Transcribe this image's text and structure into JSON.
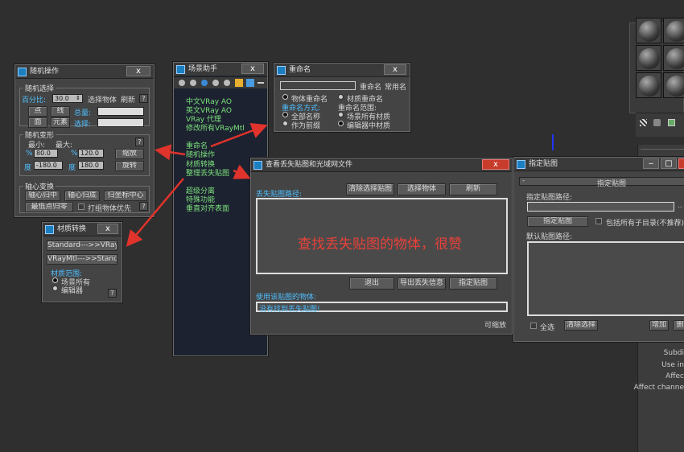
{
  "random_ops": {
    "title": "随机操作",
    "close": "x",
    "sec_random": "随机选择",
    "percent_label": "百分比:",
    "percent_value": "30.0",
    "btn_select_obj": "选择物体",
    "btn_refresh": "刷新",
    "q": "?",
    "btn_point": "点",
    "btn_line": "线",
    "btn_face": "面",
    "btn_element": "元素",
    "total_label": "总量:",
    "select_label": "选择:",
    "sec_transform": "随机变形",
    "min_label": "最小:",
    "max_label": "最大:",
    "pct": "%",
    "min_pct": "80.0",
    "max_pct": "120.0",
    "deg": "度",
    "min_deg": "-180.0",
    "max_deg": "180.0",
    "btn_scale": "缩放",
    "btn_rotate": "旋转",
    "sec_pivot": "轴心变换",
    "btn_pivot_center": "轴心归中",
    "btn_pivot_bottom": "轴心归底",
    "btn_world_center": "归坐标中心",
    "btn_lowest_zero": "最低点归零",
    "cb_group": "打组物体优先"
  },
  "mat_convert": {
    "title": "材质转换",
    "close": "x",
    "btn_std_to_vray": "Standard--->>VRayMtl",
    "btn_vray_to_std": "VRayMtl--->>Standard",
    "range_label": "材质范围:",
    "opt_scene": "场景所有",
    "opt_editor": "编辑器",
    "q": "?"
  },
  "scene_helper": {
    "title": "场景助手",
    "close": "x",
    "menu": [
      "中文VRay AO",
      "英文VRay AO",
      "VRay 代理",
      "修改所有VRayMtl",
      "",
      "重命名",
      "随机操作",
      "材质转换",
      "整理丢失贴图",
      "",
      "超级分离",
      "特殊功能",
      "垂直对齐表面"
    ]
  },
  "rename": {
    "title": "重命名",
    "close": "x",
    "btn_rename": "重命名",
    "btn_common": "常用名",
    "opt_obj": "物体重命名",
    "opt_mat": "材质重命名",
    "mode_label": "重命名方式:",
    "range_label": "重命名范围:",
    "opt_all": "全部名称",
    "opt_prefix": "作为前缀",
    "opt_scene": "场景所有材质",
    "opt_editor": "编辑器中材质"
  },
  "missing_maps": {
    "title": "查看丢失贴图和光域网文件",
    "close": "x",
    "path_label": "丢失贴图路径:",
    "btn_clear": "清除选择贴图",
    "btn_select": "选择物体",
    "btn_refresh": "刷新",
    "annotation": "查找丢失贴图的物体，很赞",
    "btn_exit": "退出",
    "btn_export": "导出丢失信息",
    "btn_assign": "指定贴图",
    "objects_label": "使用该贴图的物体:",
    "objects_value": "没有找到丢失贴图!",
    "footer": "可缩放"
  },
  "assign_map": {
    "title": "指定贴图",
    "rollout": "指定贴图",
    "rollout_sign": "-",
    "path_label": "指定贴图路径:",
    "btn_assign": "指定贴图",
    "cb_subdir": "包括所有子目录(不推荐)",
    "default_label": "默认贴图路径:",
    "cb_all": "全选",
    "btn_clear_sel": "清除选择",
    "btn_add": "增加",
    "btn_del": "删"
  },
  "max_panel": {
    "labels": [
      "Subdi",
      "Use in",
      "Affec",
      "Affect channe"
    ]
  },
  "colors": {
    "arrow": "#e0332c",
    "annotation": "#e8413a",
    "label_blue": "#4fbfff",
    "list_green": "#7ce07c"
  }
}
